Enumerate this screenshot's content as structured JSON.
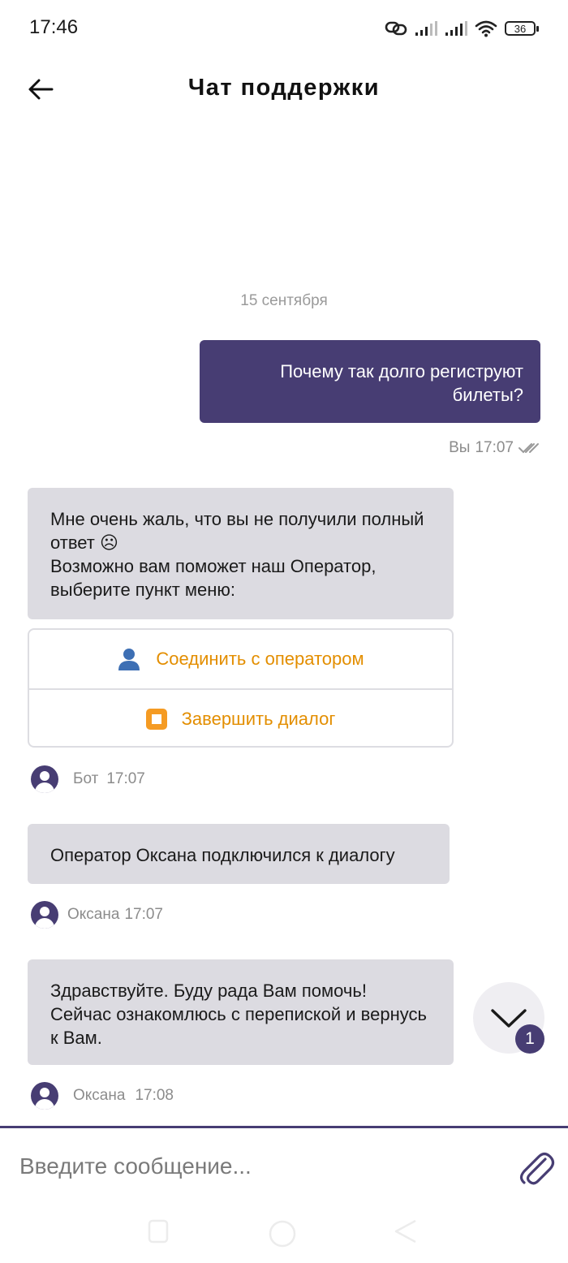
{
  "status_bar": {
    "time": "17:46",
    "battery": "36",
    "icons": [
      "link-icon",
      "signal-icon",
      "signal-icon",
      "wifi-icon",
      "battery-icon"
    ]
  },
  "header": {
    "title": "Чат поддержки",
    "back_icon": "arrow-left-icon"
  },
  "chat": {
    "date_separator": "15 сентября",
    "messages": [
      {
        "direction": "out",
        "text": "Почему так долго региструют билеты?",
        "author": "Вы",
        "time": "17:07",
        "status_icon": "double-check-icon"
      },
      {
        "direction": "in",
        "lines": [
          "Мне очень жаль, что вы не получили полный ответ ☹",
          "Возможно вам поможет наш Оператор, выберите пункт меню:"
        ],
        "author": "Бот",
        "time": "17:07"
      },
      {
        "direction": "in",
        "text": "Оператор Оксана подключился к диалогу",
        "author": "Оксана",
        "time": "17:07"
      },
      {
        "direction": "in",
        "text": "Здравствуйте. Буду рада Вам помочь! Сейчас ознакомлюсь с перепиской и вернусь к Вам.",
        "author": "Оксана",
        "time": "17:08"
      }
    ],
    "menu": [
      {
        "label": "Соединить с оператором",
        "icon": "person-icon"
      },
      {
        "label": "Завершить диалог",
        "icon": "stop-icon"
      }
    ],
    "scroll_down": {
      "icon": "chevron-down-icon",
      "badge": "1"
    }
  },
  "composer": {
    "placeholder": "Введите сообщение...",
    "attach_icon": "paperclip-icon"
  },
  "colors": {
    "accent": "#473d73",
    "bubble_in": "#dcdbe1",
    "menu_text": "#e38e00",
    "muted": "#8c8c8c"
  }
}
